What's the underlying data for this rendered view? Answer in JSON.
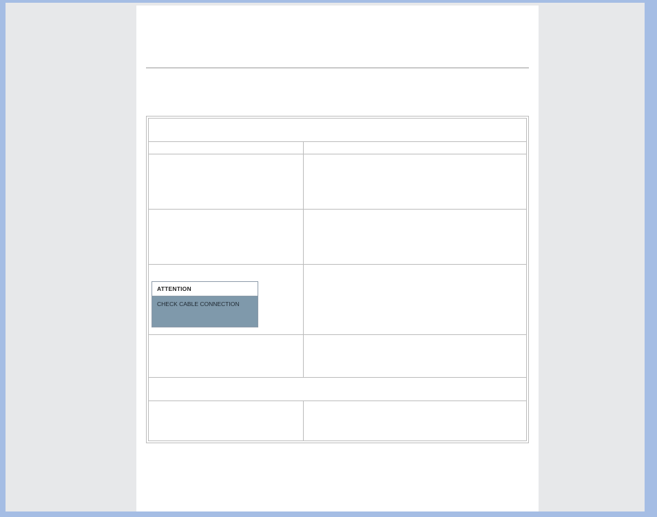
{
  "osd": {
    "title": "ATTENTION",
    "message": "CHECK CABLE CONNECTION"
  }
}
